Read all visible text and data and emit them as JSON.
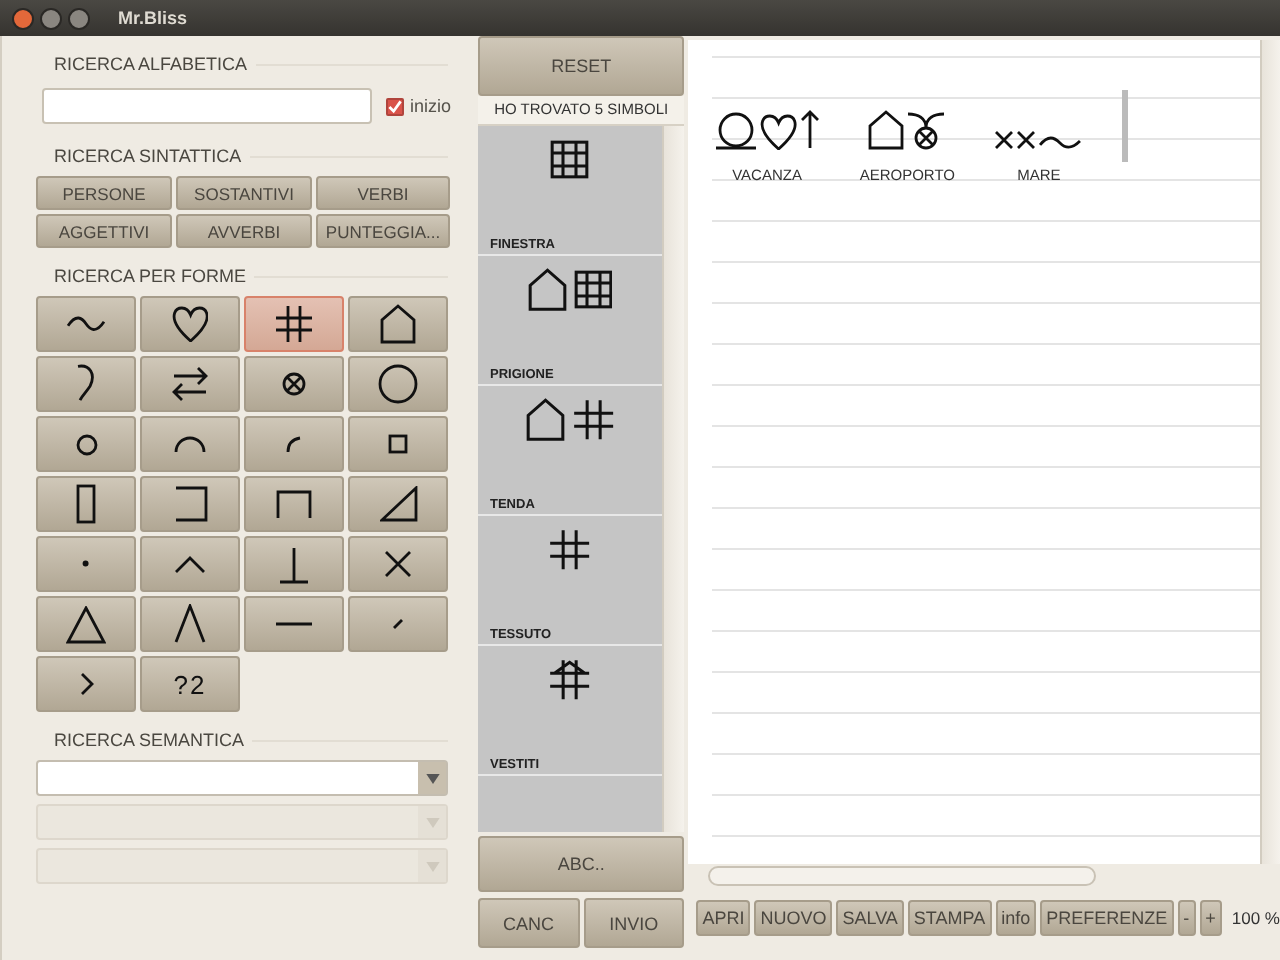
{
  "window": {
    "title": "Mr.Bliss"
  },
  "alphabetic_search": {
    "title": "RICERCA ALFABETICA",
    "checkbox": {
      "label": "inizio",
      "checked": true
    }
  },
  "syntactic_search": {
    "title": "RICERCA SINTATTICA",
    "buttons": [
      "PERSONE",
      "SOSTANTIVI",
      "VERBI",
      "AGGETTIVI",
      "AVVERBI",
      "PUNTEGGIA..."
    ]
  },
  "shape_search": {
    "title": "RICERCA PER FORME",
    "buttons": [
      {
        "kind": "tilde",
        "selected": false
      },
      {
        "kind": "heart",
        "selected": false
      },
      {
        "kind": "hash",
        "selected": true
      },
      {
        "kind": "house",
        "selected": false
      },
      {
        "kind": "curve",
        "selected": false
      },
      {
        "kind": "swap",
        "selected": false
      },
      {
        "kind": "circled-x",
        "selected": false
      },
      {
        "kind": "circle",
        "selected": false
      },
      {
        "kind": "small-circle",
        "selected": false
      },
      {
        "kind": "arch",
        "selected": false
      },
      {
        "kind": "arc",
        "selected": false
      },
      {
        "kind": "square",
        "selected": false
      },
      {
        "kind": "rect",
        "selected": false
      },
      {
        "kind": "bracket-left",
        "selected": false
      },
      {
        "kind": "bracket-top",
        "selected": false
      },
      {
        "kind": "right-triangle",
        "selected": false
      },
      {
        "kind": "dot",
        "selected": false
      },
      {
        "kind": "caret",
        "selected": false
      },
      {
        "kind": "perpendicular",
        "selected": false
      },
      {
        "kind": "cross",
        "selected": false
      },
      {
        "kind": "triangle",
        "selected": false
      },
      {
        "kind": "peak",
        "selected": false
      },
      {
        "kind": "dash",
        "selected": false
      },
      {
        "kind": "slash",
        "selected": false
      },
      {
        "kind": "chevron",
        "selected": false
      },
      {
        "kind": "text",
        "label": "?2",
        "selected": false
      }
    ]
  },
  "semantic_search": {
    "title": "RICERCA SEMANTICA",
    "dropdowns": [
      {
        "disabled": false
      },
      {
        "disabled": true
      },
      {
        "disabled": true
      }
    ]
  },
  "results": {
    "reset_button": "RESET",
    "count": "HO TROVATO 5 SIMBOLI",
    "items": [
      {
        "symbols": [
          {
            "kind": "window"
          }
        ],
        "label": "FINESTRA"
      },
      {
        "symbols": [
          {
            "kind": "house"
          },
          {
            "kind": "window"
          }
        ],
        "label": "PRIGIONE"
      },
      {
        "symbols": [
          {
            "kind": "house"
          },
          {
            "kind": "hash"
          }
        ],
        "label": "TENDA"
      },
      {
        "symbols": [
          {
            "kind": "hash"
          }
        ],
        "label": "TESSUTO"
      },
      {
        "symbols": [
          {
            "kind": "roof-hash"
          }
        ],
        "label": "VESTITI"
      }
    ],
    "abc_button": "ABC..",
    "cancel_button": "CANC",
    "send_button": "INVIO"
  },
  "canvas": {
    "words": [
      {
        "symbols": [
          {
            "kind": "ring-on-line"
          },
          {
            "kind": "heart"
          },
          {
            "kind": "arrow-up"
          }
        ],
        "label": "VACANZA"
      },
      {
        "symbols": [
          {
            "kind": "house"
          },
          {
            "kind": "horned-circled-x"
          }
        ],
        "label": "AEROPORTO"
      },
      {
        "symbols": [
          {
            "kind": "small-cross"
          },
          {
            "kind": "small-cross"
          },
          {
            "kind": "low-tilde"
          }
        ],
        "label": "MARE"
      }
    ]
  },
  "toolbar": {
    "buttons": [
      "APRI",
      "NUOVO",
      "SALVA",
      "STAMPA",
      "info",
      "PREFERENZE",
      "-",
      "+"
    ],
    "zoom": "100 %"
  }
}
